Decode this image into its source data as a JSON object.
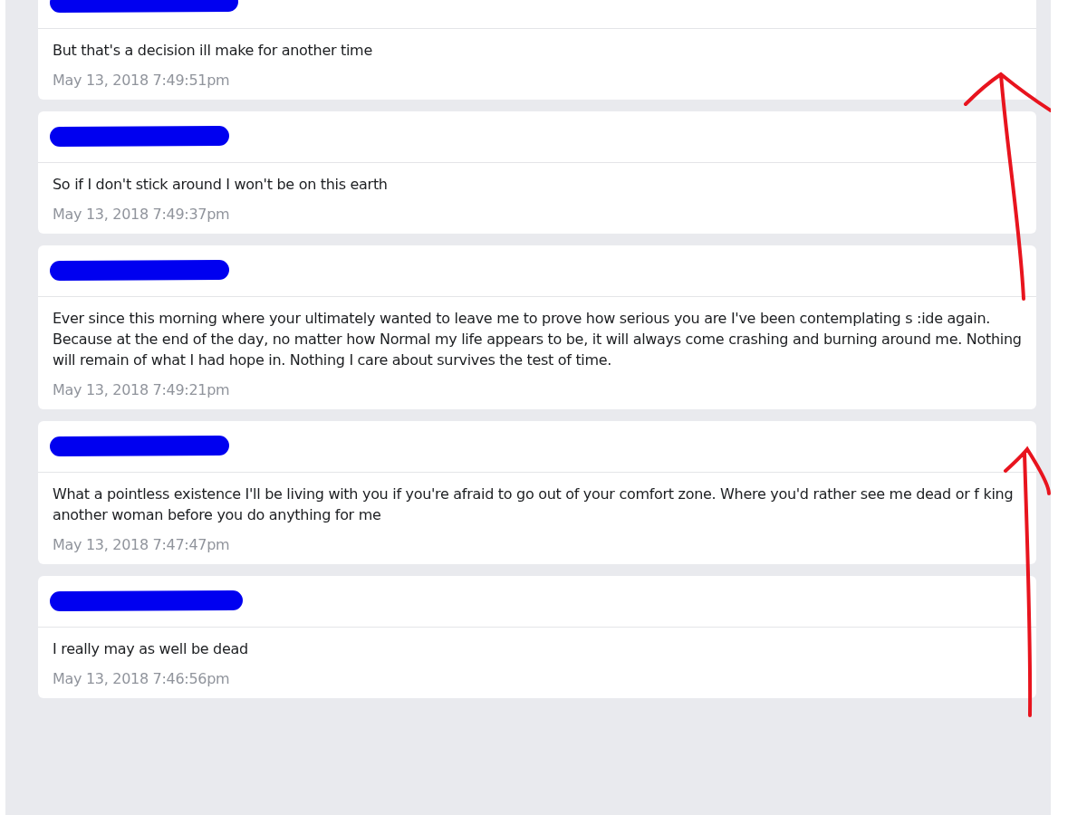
{
  "messages": [
    {
      "text": "But that's a decision ill make for another time",
      "timestamp": "May 13, 2018 7:49:51pm"
    },
    {
      "text": "So if I don't stick around I won't be on this earth",
      "timestamp": "May 13, 2018 7:49:37pm"
    },
    {
      "text": "Ever since this morning where your ultimately wanted to leave me to prove how serious you are I've been contemplating s :ide again. Because at the end of the day, no matter how Normal my life appears to be, it will always come crashing and burning around me. Nothing will remain of what I had hope in. Nothing I care about survives the test of time.",
      "timestamp": "May 13, 2018 7:49:21pm"
    },
    {
      "text": "What a pointless existence I'll be living with you if you're afraid to go out of your comfort zone. Where you'd rather see me dead or f king another woman before you do anything for me",
      "timestamp": "May 13, 2018 7:47:47pm"
    },
    {
      "text": "I really may as well be dead",
      "timestamp": "May 13, 2018 7:46:56pm"
    }
  ]
}
